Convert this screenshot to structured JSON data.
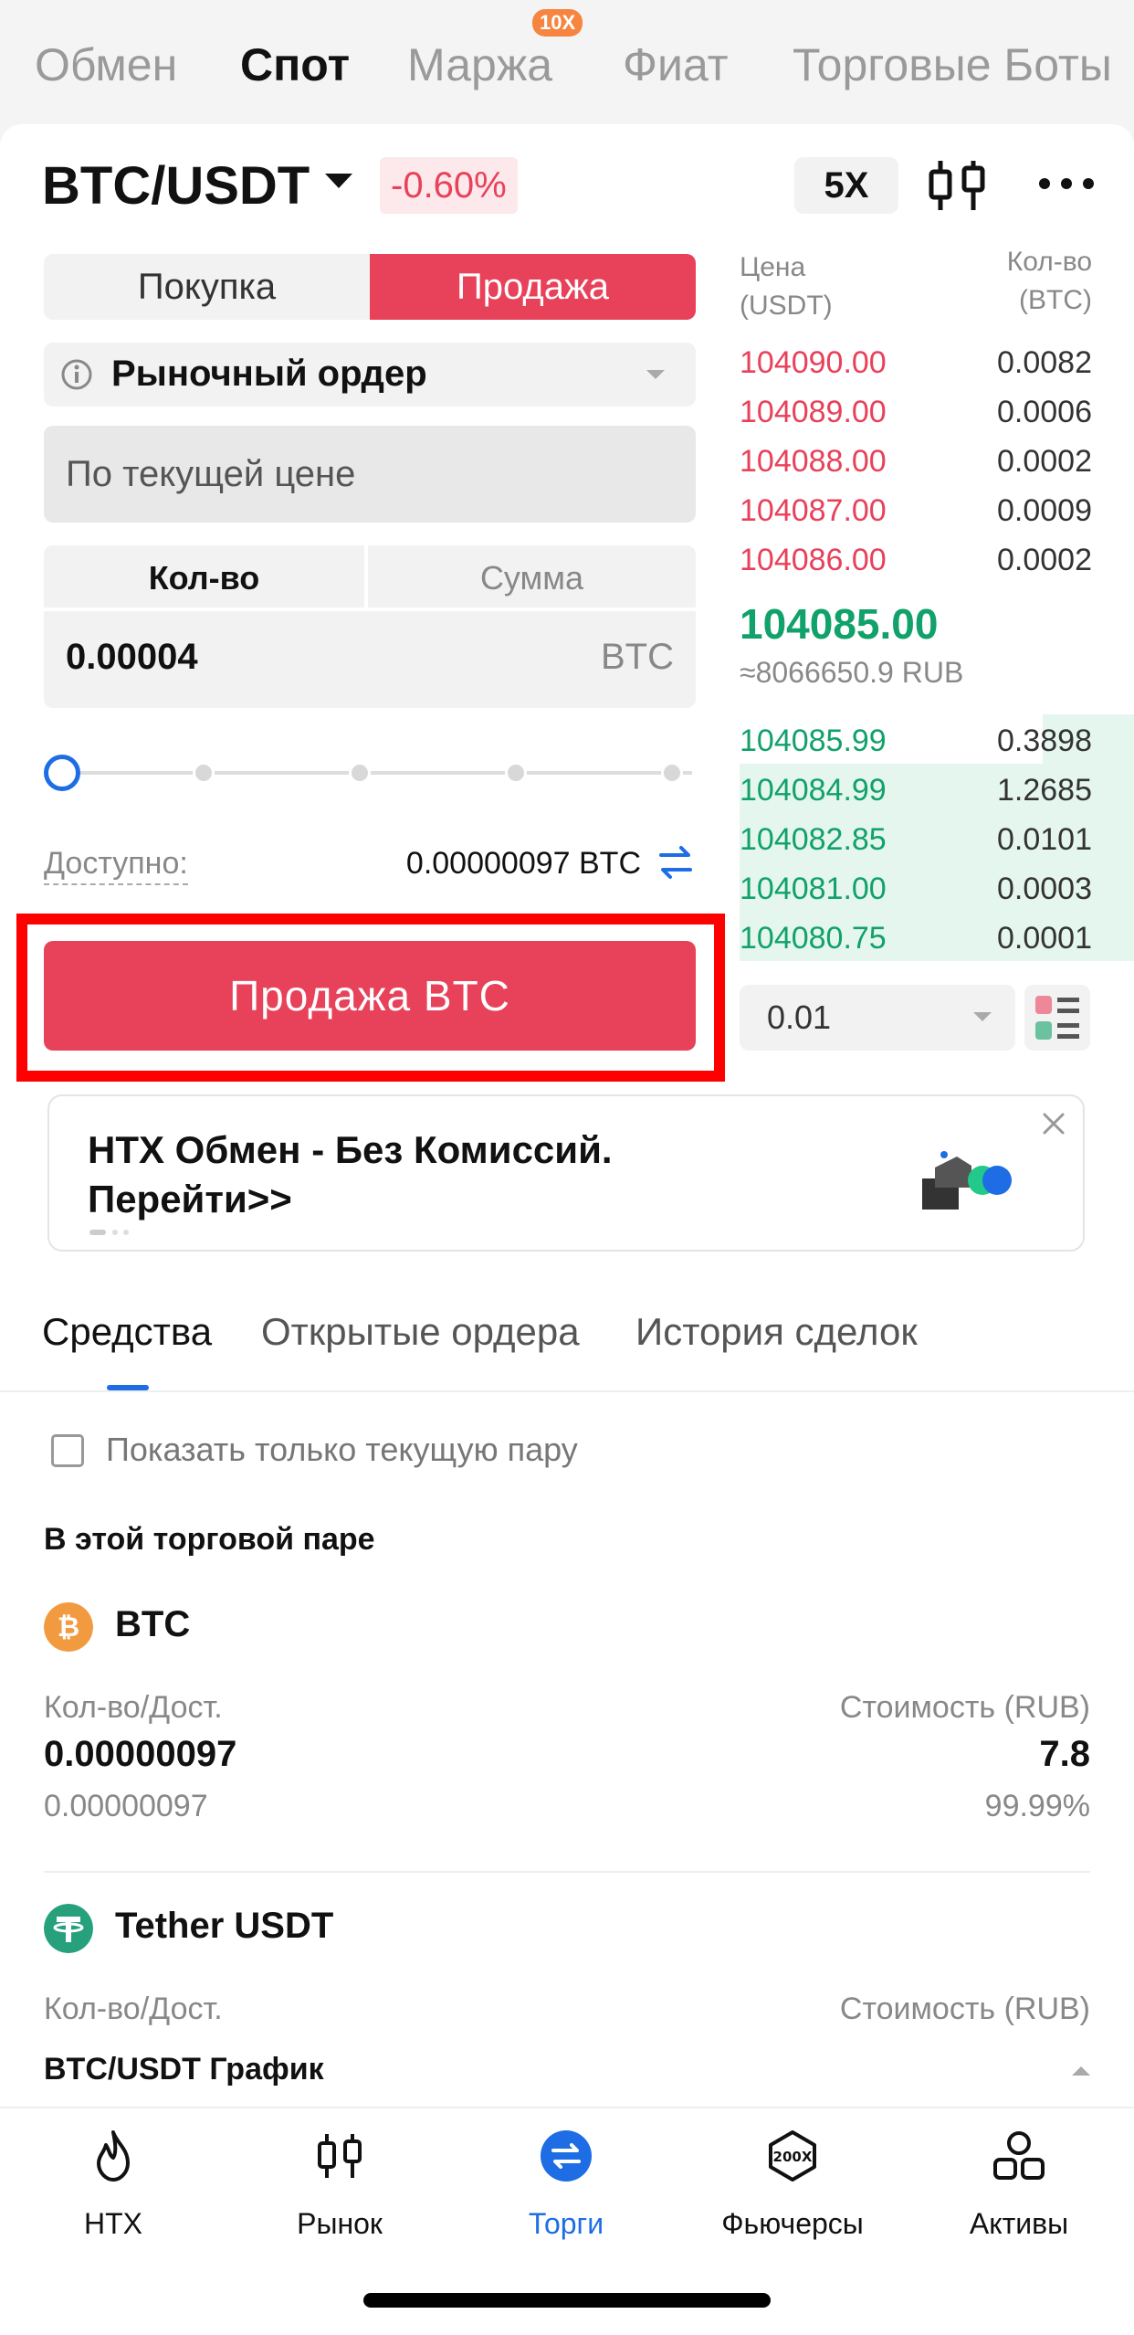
{
  "top_tabs": [
    {
      "label": "Обмен",
      "active": false
    },
    {
      "label": "Спот",
      "active": true
    },
    {
      "label": "Маржа",
      "active": false
    },
    {
      "label": "Фиат",
      "active": false
    },
    {
      "label": "Торговые Боты",
      "active": false
    }
  ],
  "margin_badge": "10X",
  "pair": {
    "symbol": "BTC/USDT",
    "change": "-0.60%",
    "leverage": "5X"
  },
  "side_toggle": {
    "buy": "Покупка",
    "sell": "Продажа",
    "selected": "sell"
  },
  "order_type": "Рыночный ордер",
  "price_field": {
    "placeholder": "По текущей цене"
  },
  "amount": {
    "tab_qty": "Кол-во",
    "tab_sum": "Сумма",
    "value": "0.00004",
    "unit": "BTC"
  },
  "available": {
    "label": "Доступно:",
    "value": "0.00000097 BTC"
  },
  "sell_button": "Продажа  BTC",
  "order_book": {
    "price_header": [
      "Цена",
      "(USDT)"
    ],
    "qty_header": [
      "Кол-во",
      "(BTC)"
    ],
    "asks": [
      {
        "price": "104090.00",
        "qty": "0.0082"
      },
      {
        "price": "104089.00",
        "qty": "0.0006"
      },
      {
        "price": "104088.00",
        "qty": "0.0002"
      },
      {
        "price": "104087.00",
        "qty": "0.0009"
      },
      {
        "price": "104086.00",
        "qty": "0.0002"
      }
    ],
    "last_price": "104085.00",
    "last_fiat": "≈8066650.9 RUB",
    "bids": [
      {
        "price": "104085.99",
        "qty": "0.3898"
      },
      {
        "price": "104084.99",
        "qty": "1.2685"
      },
      {
        "price": "104082.85",
        "qty": "0.0101"
      },
      {
        "price": "104081.00",
        "qty": "0.0003"
      },
      {
        "price": "104080.75",
        "qty": "0.0001"
      }
    ],
    "depth": "0.01"
  },
  "promo": {
    "text": "HTX Обмен - Без Комиссий. Перейти>>"
  },
  "bottom_tabs": [
    "Средства",
    "Открытые ордера",
    "История сделок"
  ],
  "filter_label": "Показать только текущую пару",
  "section_title": "В этой торговой паре",
  "assets": [
    {
      "name": "BTC",
      "qty_label": "Кол-во/Дост.",
      "value_label": "Стоимость (RUB)",
      "qty": "0.00000097",
      "avail": "0.00000097",
      "value": "7.8",
      "share": "99.99%"
    },
    {
      "name": "Tether USDT",
      "qty_label": "Кол-во/Дост.",
      "value_label": "Стоимость (RUB)"
    }
  ],
  "chart_label": "BTC/USDT График",
  "nav": [
    {
      "label": "HTX",
      "icon": "flame-icon"
    },
    {
      "label": "Рынок",
      "icon": "candles-icon"
    },
    {
      "label": "Торги",
      "icon": "trade-icon",
      "active": true
    },
    {
      "label": "Фьючерсы",
      "icon": "futures-200x-icon"
    },
    {
      "label": "Активы",
      "icon": "assets-icon"
    }
  ],
  "colors": {
    "sell": "#e8415a",
    "buy": "#11a16b",
    "accent": "#1e6de5",
    "highlight": "#ff0000"
  }
}
